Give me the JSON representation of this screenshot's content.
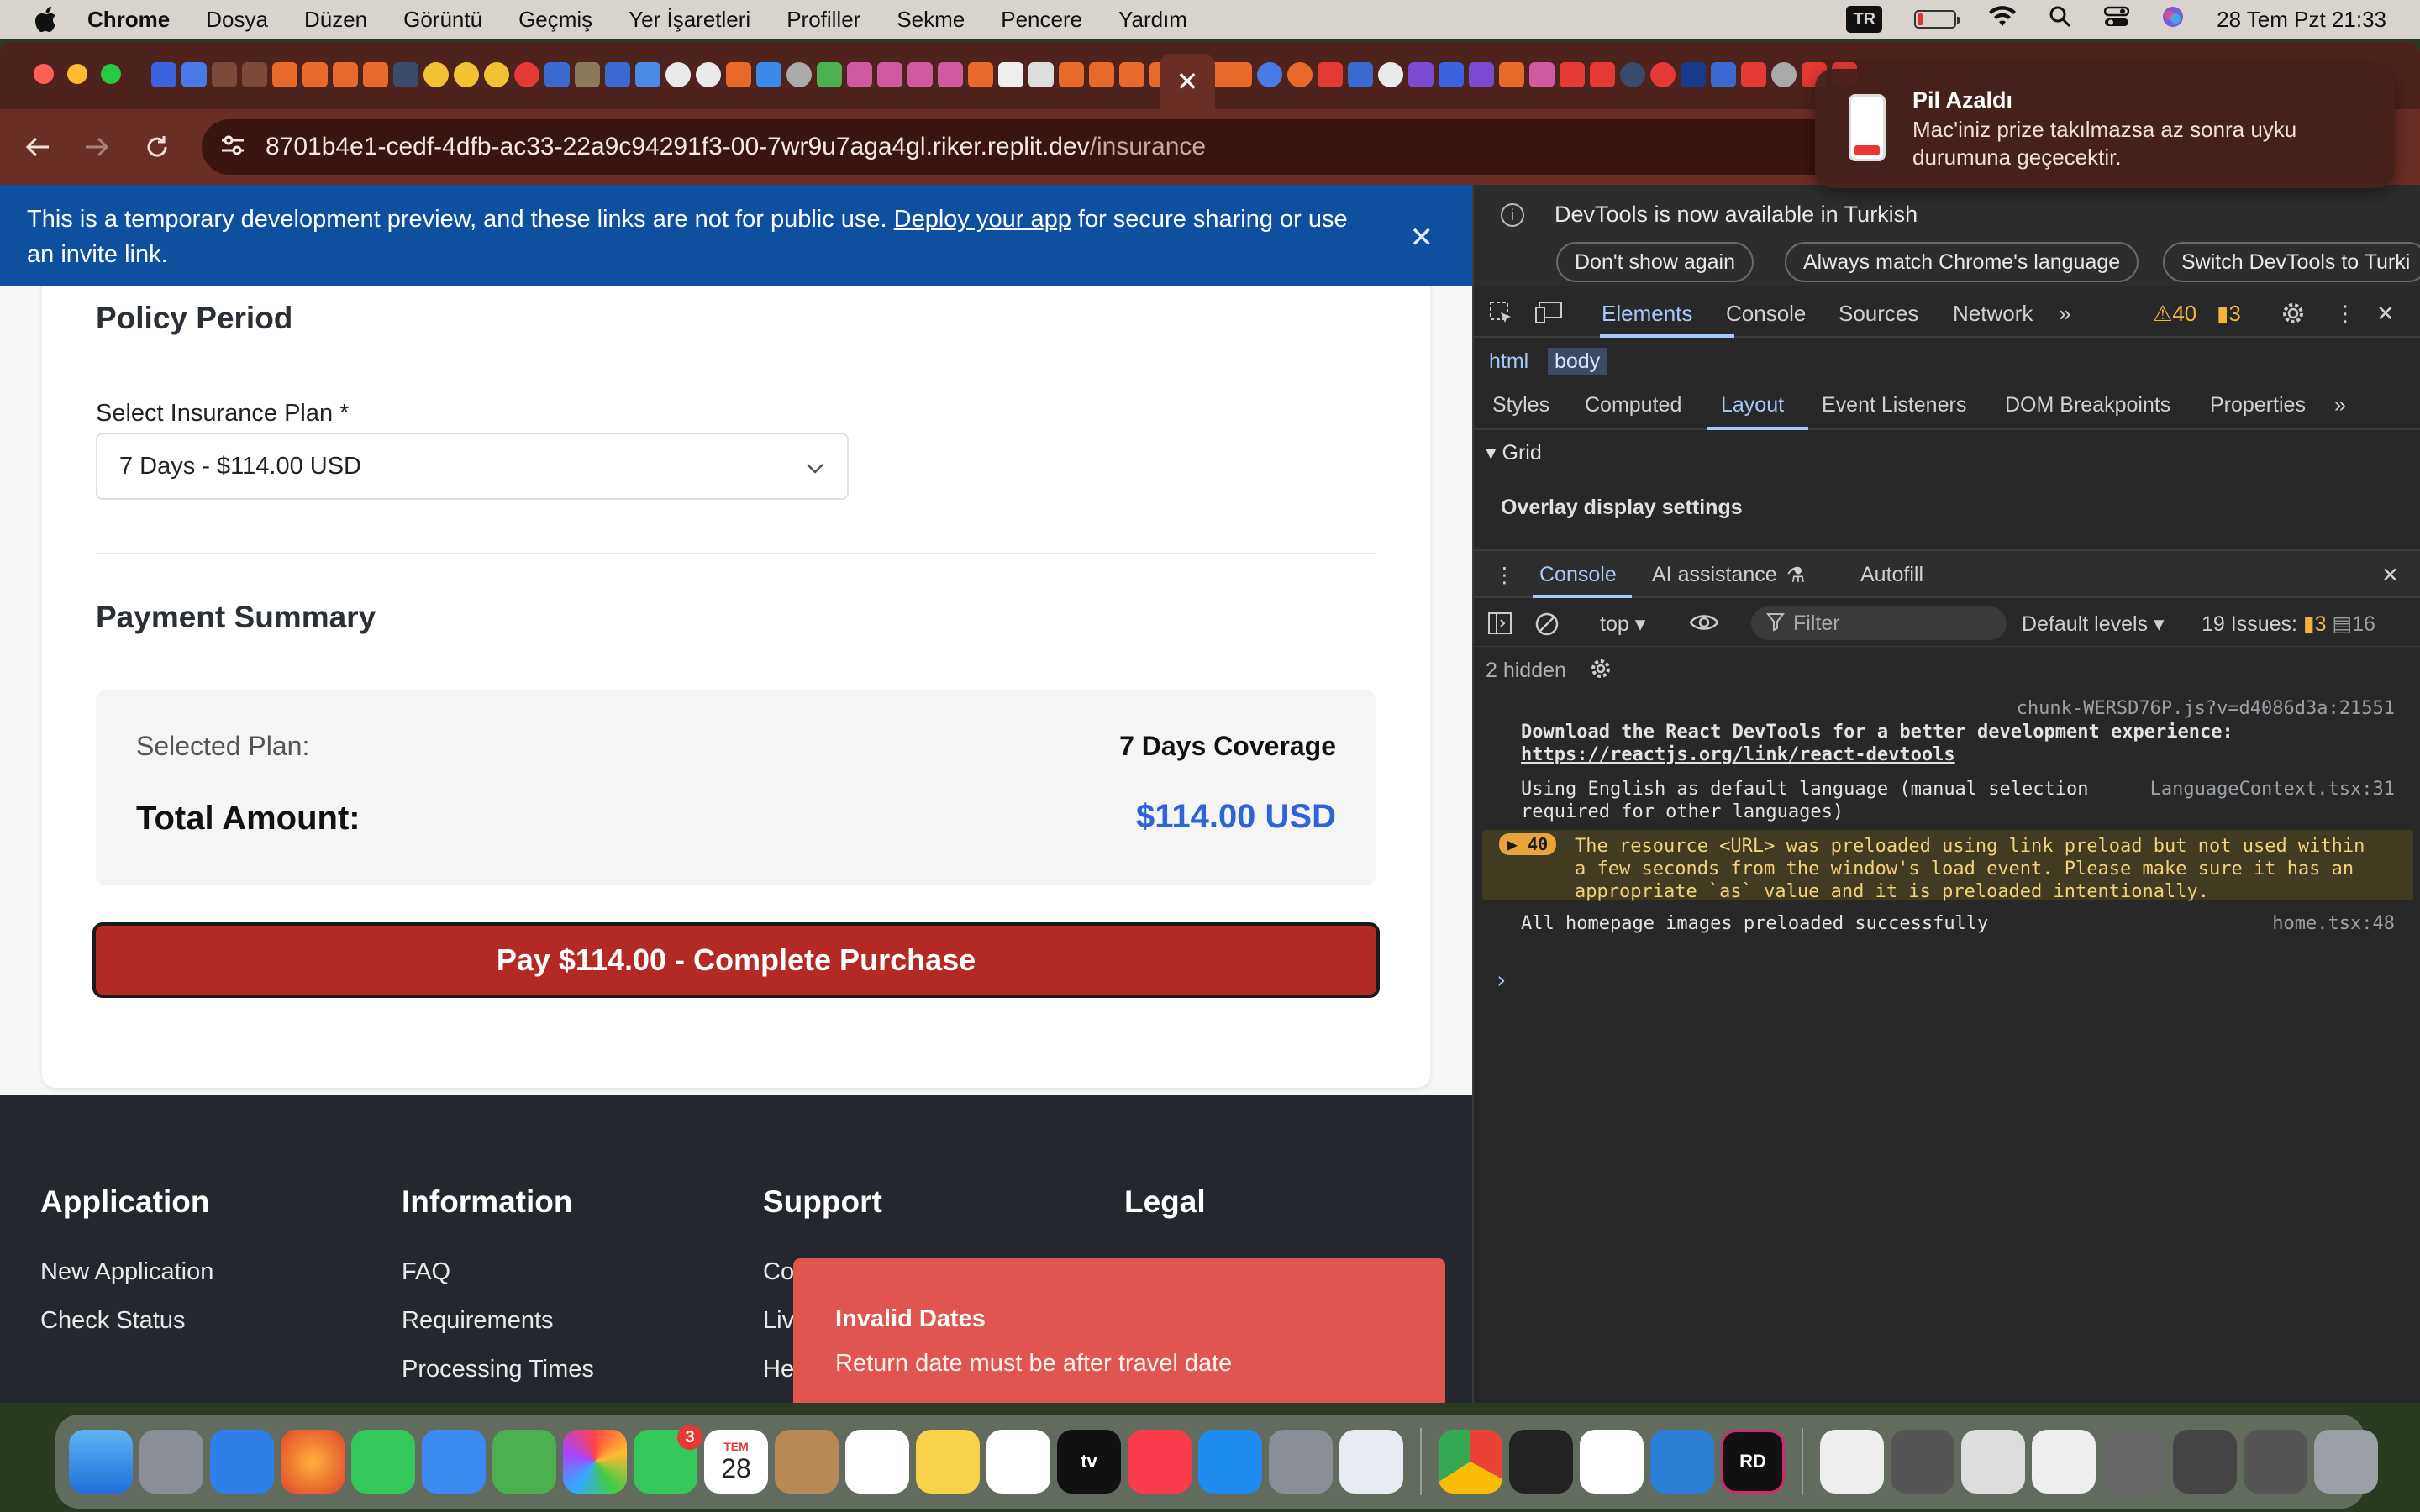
{
  "menubar": {
    "apple": "",
    "items": [
      "Chrome",
      "Dosya",
      "Düzen",
      "Görüntü",
      "Geçmiş",
      "Yer İşaretleri",
      "Profiller",
      "Sekme",
      "Pencere",
      "Yardım"
    ],
    "input_source": "TR",
    "datetime": "28 Tem Pzt  21:33"
  },
  "browser": {
    "url_host": "8701b4e1-cedf-4dfb-ac33-22a9c94291f3-00-7wr9u7aga4gl.riker.replit.dev",
    "url_path": "/insurance",
    "close_tab": "✕"
  },
  "banner": {
    "text_before": "This is a temporary development preview, and these links are not for public use. ",
    "link": "Deploy your app",
    "text_after": " for secure sharing or use an invite link.",
    "close": "✕"
  },
  "form": {
    "policy_title": "Policy Period",
    "plan_label": "Select Insurance Plan *",
    "plan_value": "7 Days - $114.00 USD",
    "summary_title": "Payment Summary",
    "selected_plan_label": "Selected Plan:",
    "selected_plan_value": "7 Days Coverage",
    "total_label": "Total Amount:",
    "total_value": "$114.00 USD",
    "pay_button": "Pay $114.00 - Complete Purchase"
  },
  "footer": {
    "columns": [
      {
        "title": "Application",
        "links": [
          "New Application",
          "Check Status"
        ]
      },
      {
        "title": "Information",
        "links": [
          "FAQ",
          "Requirements",
          "Processing Times"
        ]
      },
      {
        "title": "Support",
        "links": [
          "Co",
          "Liv",
          "He"
        ]
      },
      {
        "title": "Legal",
        "links": []
      }
    ]
  },
  "toast": {
    "title": "Invalid Dates",
    "description": "Return date must be after travel date"
  },
  "devtools": {
    "info_message": "DevTools is now available in Turkish",
    "btn_dont_show": "Don't show again",
    "btn_match": "Always match Chrome's language",
    "btn_switch": "Switch DevTools to Turki",
    "tabs": [
      "Elements",
      "Console",
      "Sources",
      "Network"
    ],
    "warn_count": "40",
    "issue_count": "3",
    "crumb_html": "html",
    "crumb_body": "body",
    "subtabs": [
      "Styles",
      "Computed",
      "Layout",
      "Event Listeners",
      "DOM Breakpoints",
      "Properties"
    ],
    "grid_label": "Grid",
    "overlay_label": "Overlay display settings",
    "drawer_tabs": [
      "Console",
      "AI assistance",
      "Autofill"
    ],
    "context": "top",
    "filter_placeholder": "Filter",
    "levels": "Default levels",
    "issues_label": "19 Issues:",
    "issues_warn": "3",
    "issues_info": "16",
    "hidden_label": "2 hidden",
    "logs": {
      "l1_src": "chunk-WERSD76P.js?v=d4086d3a:21551",
      "l1_text": "Download the React DevTools for a better development experience:",
      "l1_link": "https://reactjs.org/link/react-devtools",
      "l2_text1": "Using English as default language (manual selection",
      "l2_text2": "required for other languages)",
      "l2_src": "LanguageContext.tsx:31",
      "l3_count": "40",
      "l3_text1": "The resource <URL> was preloaded using link preload but not used within",
      "l3_text2": "a few seconds from the window's load event. Please make sure it has an",
      "l3_text3": "appropriate `as` value and it is preloaded intentionally.",
      "l4_text": "All homepage images preloaded successfully",
      "l4_src": "home.tsx:48"
    }
  },
  "notification": {
    "title": "Pil Azaldı",
    "body": "Mac'iniz prize takılmazsa az sonra uyku durumuna geçecektir."
  },
  "dock": {
    "calendar_month": "TEM",
    "calendar_day": "28",
    "facetime_badge": "3",
    "tv_label": "tv",
    "rider_label": "RD"
  }
}
